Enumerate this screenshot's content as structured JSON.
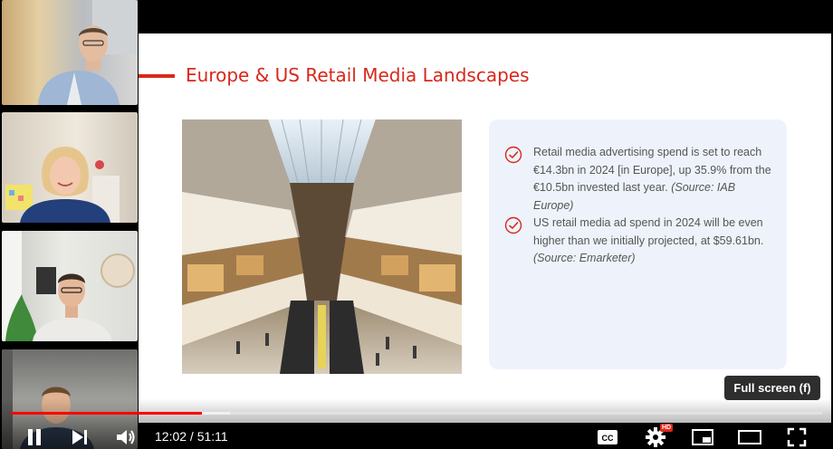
{
  "slide": {
    "title": "Europe & US Retail Media Landscapes",
    "bullets": [
      {
        "text": "Retail media advertising spend is set to reach €14.3bn in 2024 [in Europe], up 35.9% from the €10.5bn invested last year.",
        "source": "(Source: IAB Europe)"
      },
      {
        "text": "US retail media ad spend in 2024 will be even higher than we initially projected, at $59.61bn.",
        "source": "(Source: Emarketer)"
      }
    ]
  },
  "tooltip": {
    "label": "Full screen (f)"
  },
  "player": {
    "current_time": "12:02",
    "separator": " / ",
    "duration": "51:11",
    "played_fraction": 0.235,
    "loaded_fraction": 0.27,
    "hd_badge": "HD"
  },
  "participants": [
    {
      "name": "participant-1"
    },
    {
      "name": "participant-2"
    },
    {
      "name": "participant-3"
    },
    {
      "name": "participant-4"
    }
  ],
  "colors": {
    "accent": "#d8281b",
    "progress_played": "#ff0000",
    "card_bg": "#eef3fb",
    "body_text": "#555555"
  },
  "icons": [
    "check-circle-icon",
    "pause-icon",
    "next-icon",
    "volume-icon",
    "captions-icon",
    "settings-icon",
    "miniplayer-icon",
    "theater-icon",
    "fullscreen-icon"
  ]
}
